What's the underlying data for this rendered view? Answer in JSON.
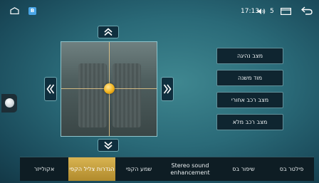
{
  "status_bar": {
    "app_badge": "B",
    "time": "17:13",
    "volume": "5",
    "icons": [
      "home-icon",
      "app-icon",
      "volume-icon",
      "window-icon",
      "back-icon"
    ]
  },
  "balance_pad": {
    "icons": [
      "chevron-up-icon",
      "chevron-down-icon",
      "double-chevron-left-icon",
      "double-chevron-right-icon"
    ],
    "knob_color": "#f1b21b"
  },
  "presets": [
    {
      "label": "מצב נהיגה"
    },
    {
      "label": "מוד משנה"
    },
    {
      "label": "מצב רכב אחורי"
    },
    {
      "label": "מצב רכב מלא"
    }
  ],
  "tabs": [
    {
      "label": "פילטר בס"
    },
    {
      "label": "שיפור בס"
    },
    {
      "label": "Stereo sound enhancement"
    },
    {
      "label": "שמע הקפי"
    },
    {
      "label": "הגדרות צליל הקפי",
      "active": true
    },
    {
      "label": "אקולייזר"
    }
  ],
  "colors": {
    "accent": "#d9b452",
    "background": "#2a6a78",
    "button_bg": "#0f2530"
  }
}
